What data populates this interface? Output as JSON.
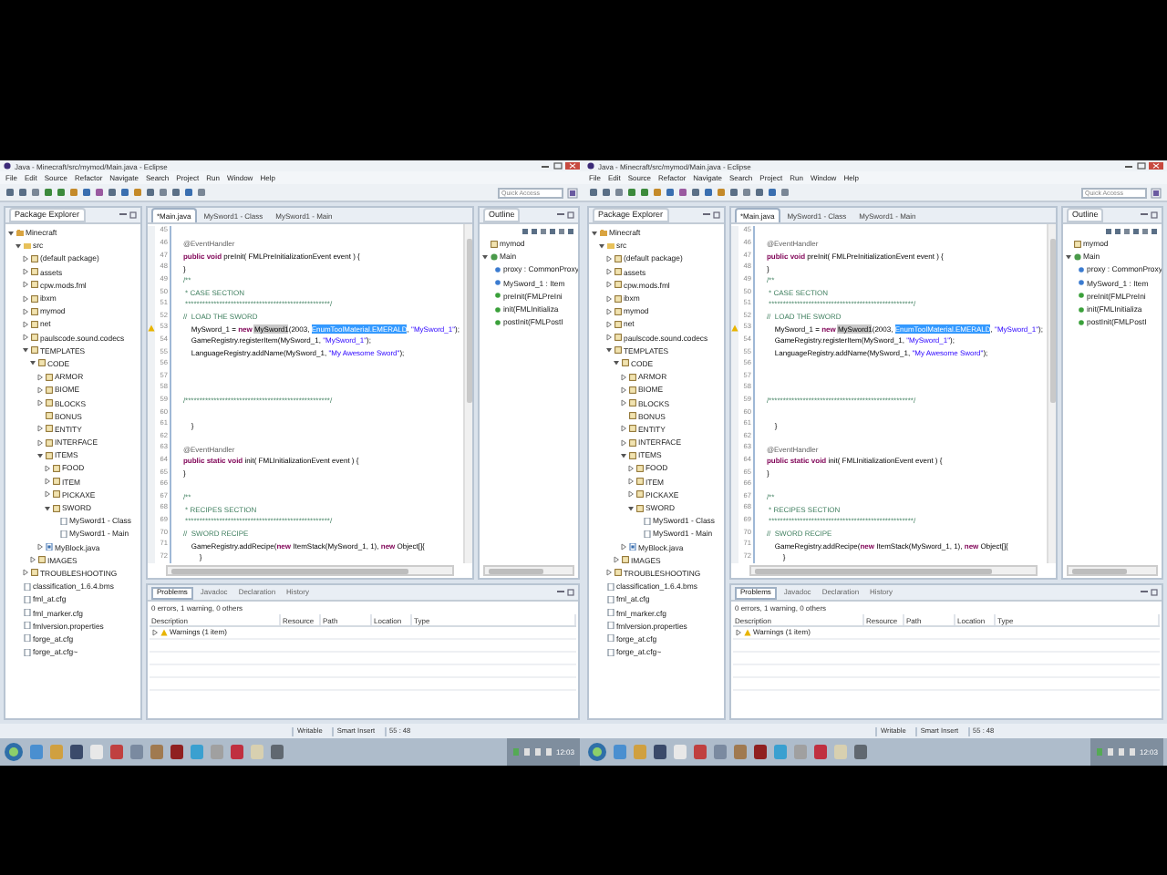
{
  "screens": [
    {
      "window": {
        "title": "Java - Minecraft/src/mymod/Main.java - Eclipse"
      },
      "menu": [
        "File",
        "Edit",
        "Source",
        "Refactor",
        "Navigate",
        "Search",
        "Project",
        "Run",
        "Window",
        "Help"
      ],
      "quick_access": {
        "placeholder": "Quick Access"
      },
      "package_explorer": {
        "title": "Package Explorer",
        "tree": [
          {
            "label": "Minecraft",
            "kind": "project",
            "expanded": true,
            "children": [
              {
                "label": "src",
                "kind": "folder",
                "expanded": true,
                "children": [
                  {
                    "label": "(default package)",
                    "kind": "package",
                    "expanded": false
                  },
                  {
                    "label": "assets",
                    "kind": "package",
                    "expanded": false
                  },
                  {
                    "label": "cpw.mods.fml",
                    "kind": "package",
                    "expanded": false
                  },
                  {
                    "label": "ibxm",
                    "kind": "package",
                    "expanded": false
                  },
                  {
                    "label": "mymod",
                    "kind": "package",
                    "expanded": false
                  },
                  {
                    "label": "net",
                    "kind": "package",
                    "expanded": false
                  },
                  {
                    "label": "paulscode.sound.codecs",
                    "kind": "package",
                    "expanded": false
                  },
                  {
                    "label": "TEMPLATES",
                    "kind": "package",
                    "expanded": true,
                    "children": [
                      {
                        "label": "CODE",
                        "kind": "package",
                        "expanded": true,
                        "children": [
                          {
                            "label": "ARMOR",
                            "kind": "package",
                            "expanded": false
                          },
                          {
                            "label": "BIOME",
                            "kind": "package",
                            "expanded": false
                          },
                          {
                            "label": "BLOCKS",
                            "kind": "package",
                            "expanded": false
                          },
                          {
                            "label": "BONUS",
                            "kind": "package"
                          },
                          {
                            "label": "ENTITY",
                            "kind": "package",
                            "expanded": false
                          },
                          {
                            "label": "INTERFACE",
                            "kind": "package",
                            "expanded": false
                          },
                          {
                            "label": "ITEMS",
                            "kind": "package",
                            "expanded": true,
                            "children": [
                              {
                                "label": "FOOD",
                                "kind": "package",
                                "expanded": false
                              },
                              {
                                "label": "ITEM",
                                "kind": "package",
                                "expanded": false
                              },
                              {
                                "label": "PICKAXE",
                                "kind": "package",
                                "expanded": false
                              },
                              {
                                "label": "SWORD",
                                "kind": "package",
                                "expanded": true,
                                "children": [
                                  {
                                    "label": "MySword1 - Class",
                                    "kind": "file"
                                  },
                                  {
                                    "label": "MySword1 - Main",
                                    "kind": "file"
                                  }
                                ]
                              }
                            ]
                          },
                          {
                            "label": "MyBlock.java",
                            "kind": "java",
                            "expanded": false
                          }
                        ]
                      },
                      {
                        "label": "IMAGES",
                        "kind": "package",
                        "expanded": false
                      }
                    ]
                  },
                  {
                    "label": "TROUBLESHOOTING",
                    "kind": "package",
                    "expanded": false
                  }
                ]
              },
              {
                "label": "classification_1.6.4.bms",
                "kind": "file"
              },
              {
                "label": "fml_at.cfg",
                "kind": "file"
              },
              {
                "label": "fml_marker.cfg",
                "kind": "file"
              },
              {
                "label": "fmlversion.properties",
                "kind": "file"
              },
              {
                "label": "forge_at.cfg",
                "kind": "file"
              },
              {
                "label": "forge_at.cfg~",
                "kind": "file"
              }
            ]
          }
        ]
      },
      "editor": {
        "tabs": [
          {
            "label": "*Main.java",
            "selected": true
          },
          {
            "label": "MySword1 - Class",
            "selected": false
          },
          {
            "label": "MySword1 - Main",
            "selected": false
          }
        ],
        "lines": [
          {
            "no": "45",
            "warning": false
          },
          {
            "no": "46",
            "warning": false,
            "segments": [
              {
                "kind": "annotation",
                "text": "    @EventHandler"
              }
            ]
          },
          {
            "no": "47",
            "warning": false,
            "segments": [
              {
                "kind": "keyword",
                "text": "    public void "
              },
              {
                "kind": "plain",
                "text": "preInit( FMLPreInitializationEvent event ) {"
              }
            ]
          },
          {
            "no": "48",
            "warning": false,
            "segments": [
              {
                "kind": "plain",
                "text": "    }"
              }
            ]
          },
          {
            "no": "49",
            "warning": false,
            "segments": [
              {
                "kind": "comment",
                "text": "    /**"
              }
            ]
          },
          {
            "no": "50",
            "warning": false,
            "segments": [
              {
                "kind": "comment",
                "text": "     * CASE SECTION"
              }
            ]
          },
          {
            "no": "51",
            "warning": false,
            "segments": [
              {
                "kind": "comment",
                "text": "     ***************************************************/"
              }
            ]
          },
          {
            "no": "52",
            "warning": false,
            "segments": [
              {
                "kind": "comment",
                "text": "    //  LOAD THE SWORD"
              }
            ]
          },
          {
            "no": "53",
            "warning": true,
            "segments": [
              {
                "kind": "plain",
                "text": "        MySword_1 = "
              },
              {
                "kind": "keyword",
                "text": "new "
              },
              {
                "kind": "occurrence",
                "text": "MySword1"
              },
              {
                "kind": "plain",
                "text": "(2003, "
              },
              {
                "kind": "selection",
                "text": "EnumToolMaterial.EMERALD"
              },
              {
                "kind": "plain",
                "text": ", "
              },
              {
                "kind": "string",
                "text": "\"MySword_1\""
              },
              {
                "kind": "plain",
                "text": ");"
              }
            ]
          },
          {
            "no": "54",
            "warning": false,
            "segments": [
              {
                "kind": "plain",
                "text": "        GameRegistry.registerItem(MySword_1, "
              },
              {
                "kind": "string",
                "text": "\"MySword_1\""
              },
              {
                "kind": "plain",
                "text": ");"
              }
            ]
          },
          {
            "no": "55",
            "warning": false,
            "segments": [
              {
                "kind": "plain",
                "text": "        LanguageRegistry.addName(MySword_1, "
              },
              {
                "kind": "string",
                "text": "\"My Awesome Sword\""
              },
              {
                "kind": "plain",
                "text": ");"
              }
            ]
          },
          {
            "no": "56",
            "warning": false
          },
          {
            "no": "57",
            "warning": false
          },
          {
            "no": "58",
            "warning": false
          },
          {
            "no": "59",
            "warning": false,
            "segments": [
              {
                "kind": "comment",
                "text": "    /***************************************************/"
              }
            ]
          },
          {
            "no": "60",
            "warning": false
          },
          {
            "no": "61",
            "warning": false,
            "segments": [
              {
                "kind": "plain",
                "text": "        }"
              }
            ]
          },
          {
            "no": "62",
            "warning": false
          },
          {
            "no": "63",
            "warning": false,
            "segments": [
              {
                "kind": "annotation",
                "text": "    @EventHandler"
              }
            ]
          },
          {
            "no": "64",
            "warning": false,
            "segments": [
              {
                "kind": "keyword",
                "text": "    public static void "
              },
              {
                "kind": "plain",
                "text": "init( FMLInitializationEvent event ) {"
              }
            ]
          },
          {
            "no": "65",
            "warning": false,
            "segments": [
              {
                "kind": "plain",
                "text": "    }"
              }
            ]
          },
          {
            "no": "66",
            "warning": false
          },
          {
            "no": "67",
            "warning": false,
            "segments": [
              {
                "kind": "comment",
                "text": "    /**"
              }
            ]
          },
          {
            "no": "68",
            "warning": false,
            "segments": [
              {
                "kind": "comment",
                "text": "     * RECIPES SECTION"
              }
            ]
          },
          {
            "no": "69",
            "warning": false,
            "segments": [
              {
                "kind": "comment",
                "text": "     ***************************************************/"
              }
            ]
          },
          {
            "no": "70",
            "warning": false,
            "segments": [
              {
                "kind": "comment",
                "text": "    //  SWORD RECIPE"
              }
            ]
          },
          {
            "no": "71",
            "warning": false,
            "segments": [
              {
                "kind": "plain",
                "text": "        GameRegistry.addRecipe("
              },
              {
                "kind": "keyword",
                "text": "new "
              },
              {
                "kind": "plain",
                "text": "ItemStack(MySword_1, 1), "
              },
              {
                "kind": "keyword",
                "text": "new "
              },
              {
                "kind": "plain",
                "text": "Object[]{"
              }
            ]
          },
          {
            "no": "72",
            "warning": false,
            "segments": [
              {
                "kind": "plain",
                "text": "            }"
              }
            ]
          }
        ]
      },
      "outline": {
        "title": "Outline",
        "tree": [
          {
            "label": "mymod",
            "kind": "package"
          },
          {
            "label": "Main",
            "kind": "class",
            "expanded": true,
            "children": [
              {
                "label": "proxy : CommonProxy",
                "kind": "field"
              },
              {
                "label": "MySword_1 : Item",
                "kind": "field"
              },
              {
                "label": "preInit(FMLPreIni",
                "kind": "method"
              },
              {
                "label": "init(FMLInitializa",
                "kind": "method"
              },
              {
                "label": "postInit(FMLPostI",
                "kind": "method"
              }
            ]
          }
        ]
      },
      "problems": {
        "tabs": [
          {
            "label": "Problems",
            "selected": true
          },
          {
            "label": "Javadoc",
            "selected": false
          },
          {
            "label": "Declaration",
            "selected": false
          },
          {
            "label": "History",
            "selected": false
          }
        ],
        "summary": "0 errors, 1 warning, 0 others",
        "columns": [
          "Description",
          "Resource",
          "Path",
          "Location",
          "Type"
        ],
        "rows": [
          {
            "description": "Warnings (1 item)",
            "expanded": false
          }
        ]
      },
      "status_bar": [
        "Writable",
        "Smart Insert",
        "55 : 48"
      ],
      "taskbar": {
        "clock": "12:03"
      }
    },
    {
      "window": {
        "title": "Java - Minecraft/src/mymod/Main.java - Eclipse"
      },
      "menu": [
        "File",
        "Edit",
        "Source",
        "Refactor",
        "Navigate",
        "Search",
        "Project",
        "Run",
        "Window",
        "Help"
      ],
      "quick_access": {
        "placeholder": "Quick Access"
      },
      "package_explorer": {
        "title": "Package Explorer",
        "tree": [
          {
            "label": "Minecraft",
            "kind": "project",
            "expanded": true,
            "children": [
              {
                "label": "src",
                "kind": "folder",
                "expanded": true,
                "children": [
                  {
                    "label": "(default package)",
                    "kind": "package",
                    "expanded": false
                  },
                  {
                    "label": "assets",
                    "kind": "package",
                    "expanded": false
                  },
                  {
                    "label": "cpw.mods.fml",
                    "kind": "package",
                    "expanded": false
                  },
                  {
                    "label": "ibxm",
                    "kind": "package",
                    "expanded": false
                  },
                  {
                    "label": "mymod",
                    "kind": "package",
                    "expanded": false
                  },
                  {
                    "label": "net",
                    "kind": "package",
                    "expanded": false
                  },
                  {
                    "label": "paulscode.sound.codecs",
                    "kind": "package",
                    "expanded": false
                  },
                  {
                    "label": "TEMPLATES",
                    "kind": "package",
                    "expanded": true,
                    "children": [
                      {
                        "label": "CODE",
                        "kind": "package",
                        "expanded": true,
                        "children": [
                          {
                            "label": "ARMOR",
                            "kind": "package",
                            "expanded": false
                          },
                          {
                            "label": "BIOME",
                            "kind": "package",
                            "expanded": false
                          },
                          {
                            "label": "BLOCKS",
                            "kind": "package",
                            "expanded": false
                          },
                          {
                            "label": "BONUS",
                            "kind": "package"
                          },
                          {
                            "label": "ENTITY",
                            "kind": "package",
                            "expanded": false
                          },
                          {
                            "label": "INTERFACE",
                            "kind": "package",
                            "expanded": false
                          },
                          {
                            "label": "ITEMS",
                            "kind": "package",
                            "expanded": true,
                            "children": [
                              {
                                "label": "FOOD",
                                "kind": "package",
                                "expanded": false
                              },
                              {
                                "label": "ITEM",
                                "kind": "package",
                                "expanded": false
                              },
                              {
                                "label": "PICKAXE",
                                "kind": "package",
                                "expanded": false
                              },
                              {
                                "label": "SWORD",
                                "kind": "package",
                                "expanded": true,
                                "children": [
                                  {
                                    "label": "MySword1 - Class",
                                    "kind": "file"
                                  },
                                  {
                                    "label": "MySword1 - Main",
                                    "kind": "file"
                                  }
                                ]
                              }
                            ]
                          },
                          {
                            "label": "MyBlock.java",
                            "kind": "java",
                            "expanded": false
                          }
                        ]
                      },
                      {
                        "label": "IMAGES",
                        "kind": "package",
                        "expanded": false
                      }
                    ]
                  },
                  {
                    "label": "TROUBLESHOOTING",
                    "kind": "package",
                    "expanded": false
                  }
                ]
              },
              {
                "label": "classification_1.6.4.bms",
                "kind": "file"
              },
              {
                "label": "fml_at.cfg",
                "kind": "file"
              },
              {
                "label": "fml_marker.cfg",
                "kind": "file"
              },
              {
                "label": "fmlversion.properties",
                "kind": "file"
              },
              {
                "label": "forge_at.cfg",
                "kind": "file"
              },
              {
                "label": "forge_at.cfg~",
                "kind": "file"
              }
            ]
          }
        ]
      },
      "editor": {
        "tabs": [
          {
            "label": "*Main.java",
            "selected": true
          },
          {
            "label": "MySword1 - Class",
            "selected": false
          },
          {
            "label": "MySword1 - Main",
            "selected": false
          }
        ],
        "lines": [
          {
            "no": "45",
            "warning": false
          },
          {
            "no": "46",
            "warning": false,
            "segments": [
              {
                "kind": "annotation",
                "text": "    @EventHandler"
              }
            ]
          },
          {
            "no": "47",
            "warning": false,
            "segments": [
              {
                "kind": "keyword",
                "text": "    public void "
              },
              {
                "kind": "plain",
                "text": "preInit( FMLPreInitializationEvent event ) {"
              }
            ]
          },
          {
            "no": "48",
            "warning": false,
            "segments": [
              {
                "kind": "plain",
                "text": "    }"
              }
            ]
          },
          {
            "no": "49",
            "warning": false,
            "segments": [
              {
                "kind": "comment",
                "text": "    /**"
              }
            ]
          },
          {
            "no": "50",
            "warning": false,
            "segments": [
              {
                "kind": "comment",
                "text": "     * CASE SECTION"
              }
            ]
          },
          {
            "no": "51",
            "warning": false,
            "segments": [
              {
                "kind": "comment",
                "text": "     ***************************************************/"
              }
            ]
          },
          {
            "no": "52",
            "warning": false,
            "segments": [
              {
                "kind": "comment",
                "text": "    //  LOAD THE SWORD"
              }
            ]
          },
          {
            "no": "53",
            "warning": true,
            "segments": [
              {
                "kind": "plain",
                "text": "        MySword_1 = "
              },
              {
                "kind": "keyword",
                "text": "new "
              },
              {
                "kind": "occurrence",
                "text": "MySword1"
              },
              {
                "kind": "plain",
                "text": "(2003, "
              },
              {
                "kind": "selection",
                "text": "EnumToolMaterial.EMERALD"
              },
              {
                "kind": "plain",
                "text": ", "
              },
              {
                "kind": "string",
                "text": "\"MySword_1\""
              },
              {
                "kind": "plain",
                "text": ");"
              }
            ]
          },
          {
            "no": "54",
            "warning": false,
            "segments": [
              {
                "kind": "plain",
                "text": "        GameRegistry.registerItem(MySword_1, "
              },
              {
                "kind": "string",
                "text": "\"MySword_1\""
              },
              {
                "kind": "plain",
                "text": ");"
              }
            ]
          },
          {
            "no": "55",
            "warning": false,
            "segments": [
              {
                "kind": "plain",
                "text": "        LanguageRegistry.addName(MySword_1, "
              },
              {
                "kind": "string",
                "text": "\"My Awesome Sword\""
              },
              {
                "kind": "plain",
                "text": ");"
              }
            ]
          },
          {
            "no": "56",
            "warning": false
          },
          {
            "no": "57",
            "warning": false
          },
          {
            "no": "58",
            "warning": false
          },
          {
            "no": "59",
            "warning": false,
            "segments": [
              {
                "kind": "comment",
                "text": "    /***************************************************/"
              }
            ]
          },
          {
            "no": "60",
            "warning": false
          },
          {
            "no": "61",
            "warning": false,
            "segments": [
              {
                "kind": "plain",
                "text": "        }"
              }
            ]
          },
          {
            "no": "62",
            "warning": false
          },
          {
            "no": "63",
            "warning": false,
            "segments": [
              {
                "kind": "annotation",
                "text": "    @EventHandler"
              }
            ]
          },
          {
            "no": "64",
            "warning": false,
            "segments": [
              {
                "kind": "keyword",
                "text": "    public static void "
              },
              {
                "kind": "plain",
                "text": "init( FMLInitializationEvent event ) {"
              }
            ]
          },
          {
            "no": "65",
            "warning": false,
            "segments": [
              {
                "kind": "plain",
                "text": "    }"
              }
            ]
          },
          {
            "no": "66",
            "warning": false
          },
          {
            "no": "67",
            "warning": false,
            "segments": [
              {
                "kind": "comment",
                "text": "    /**"
              }
            ]
          },
          {
            "no": "68",
            "warning": false,
            "segments": [
              {
                "kind": "comment",
                "text": "     * RECIPES SECTION"
              }
            ]
          },
          {
            "no": "69",
            "warning": false,
            "segments": [
              {
                "kind": "comment",
                "text": "     ***************************************************/"
              }
            ]
          },
          {
            "no": "70",
            "warning": false,
            "segments": [
              {
                "kind": "comment",
                "text": "    //  SWORD RECIPE"
              }
            ]
          },
          {
            "no": "71",
            "warning": false,
            "segments": [
              {
                "kind": "plain",
                "text": "        GameRegistry.addRecipe("
              },
              {
                "kind": "keyword",
                "text": "new "
              },
              {
                "kind": "plain",
                "text": "ItemStack(MySword_1, 1), "
              },
              {
                "kind": "keyword",
                "text": "new "
              },
              {
                "kind": "plain",
                "text": "Object[]{"
              }
            ]
          },
          {
            "no": "72",
            "warning": false,
            "segments": [
              {
                "kind": "plain",
                "text": "            }"
              }
            ]
          }
        ]
      },
      "outline": {
        "title": "Outline",
        "tree": [
          {
            "label": "mymod",
            "kind": "package"
          },
          {
            "label": "Main",
            "kind": "class",
            "expanded": true,
            "children": [
              {
                "label": "proxy : CommonProxy",
                "kind": "field"
              },
              {
                "label": "MySword_1 : Item",
                "kind": "field"
              },
              {
                "label": "preInit(FMLPreIni",
                "kind": "method"
              },
              {
                "label": "init(FMLInitializa",
                "kind": "method"
              },
              {
                "label": "postInit(FMLPostI",
                "kind": "method"
              }
            ]
          }
        ]
      },
      "problems": {
        "tabs": [
          {
            "label": "Problems",
            "selected": true
          },
          {
            "label": "Javadoc",
            "selected": false
          },
          {
            "label": "Declaration",
            "selected": false
          },
          {
            "label": "History",
            "selected": false
          }
        ],
        "summary": "0 errors, 1 warning, 0 others",
        "columns": [
          "Description",
          "Resource",
          "Path",
          "Location",
          "Type"
        ],
        "rows": [
          {
            "description": "Warnings (1 item)",
            "expanded": false
          }
        ]
      },
      "status_bar": [
        "Writable",
        "Smart Insert",
        "55 : 48"
      ],
      "taskbar": {
        "clock": "12:03"
      }
    }
  ]
}
